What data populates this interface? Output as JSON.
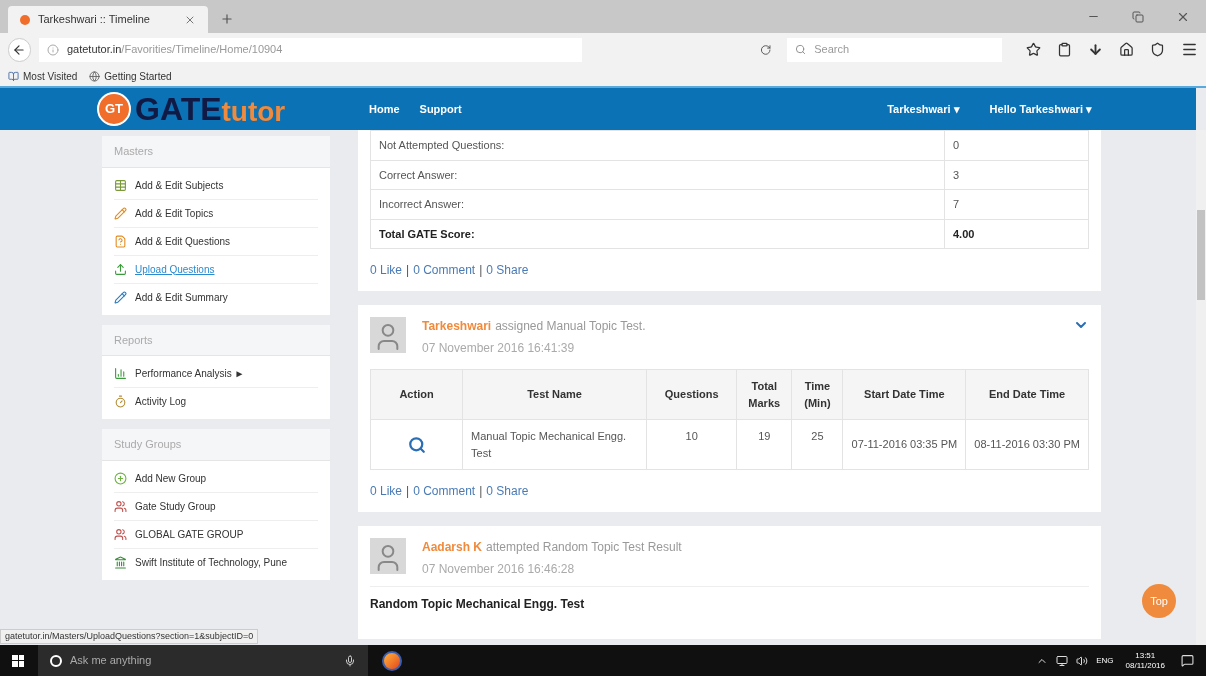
{
  "browser": {
    "tab_title": "Tarkeshwari :: Timeline",
    "url_host": "gatetutor.in",
    "url_path": "/Favorities/Timeline/Home/10904",
    "search_placeholder": "Search",
    "bookmarks": [
      "Most Visited",
      "Getting Started"
    ]
  },
  "header": {
    "logo": {
      "badge": "GT",
      "main": "GATE",
      "accent": "tutor"
    },
    "nav": [
      "Home",
      "Support"
    ],
    "menus": [
      "Tarkeshwari ▾",
      "Hello Tarkeshwari ▾"
    ]
  },
  "sidebar": {
    "sections": [
      {
        "title": "Masters",
        "items": [
          {
            "label": "Add & Edit Subjects",
            "hovered": false
          },
          {
            "label": "Add & Edit Topics",
            "hovered": false
          },
          {
            "label": "Add & Edit Questions",
            "hovered": false
          },
          {
            "label": "Upload Questions",
            "hovered": true
          },
          {
            "label": "Add & Edit Summary",
            "hovered": false
          }
        ]
      },
      {
        "title": "Reports",
        "items": [
          {
            "label": "Performance Analysis ►",
            "hovered": false
          },
          {
            "label": "Activity Log",
            "hovered": false
          }
        ]
      },
      {
        "title": "Study Groups",
        "items": [
          {
            "label": "Add New Group",
            "hovered": false
          },
          {
            "label": "Gate Study Group",
            "hovered": false
          },
          {
            "label": "GLOBAL GATE GROUP",
            "hovered": false
          },
          {
            "label": "Swift Institute of Technology, Pune",
            "hovered": false
          }
        ]
      }
    ]
  },
  "feed": {
    "link_separator": "|",
    "result_post": {
      "rows": [
        {
          "label": "Not Attempted Questions:",
          "value": "0",
          "bold": false
        },
        {
          "label": "Correct Answer:",
          "value": "3",
          "bold": false
        },
        {
          "label": "Incorrect Answer:",
          "value": "7",
          "bold": false
        },
        {
          "label": "Total GATE Score:",
          "value": "4.00",
          "bold": true
        }
      ],
      "links": [
        "0 Like",
        "0 Comment",
        "0 Share"
      ]
    },
    "assign_post": {
      "author": "Tarkeshwari",
      "action": "assigned Manual Topic Test.",
      "time": "07 November 2016 16:41:39",
      "expanded": false,
      "table": {
        "columns": [
          "Action",
          "Test Name",
          "Questions",
          "Total Marks",
          "Time (Min)",
          "Start Date Time",
          "End Date Time"
        ],
        "rows": [
          {
            "test_name": "Manual Topic Mechanical Engg. Test",
            "questions": "10",
            "total_marks": "19",
            "time": "25",
            "start": "07-11-2016 03:35 PM",
            "end": "08-11-2016 03:30 PM"
          }
        ]
      },
      "links": [
        "0 Like",
        "0 Comment",
        "0 Share"
      ]
    },
    "attempt_post": {
      "author": "Aadarsh K",
      "action": "attempted Random Topic Test Result",
      "time": "07 November 2016 16:46:28",
      "title": "Random Topic Mechanical Engg. Test"
    }
  },
  "top_button": "Top",
  "status_link": "gatetutor.in/Masters/UploadQuestions?section=1&subjectID=0",
  "taskbar": {
    "search_placeholder": "Ask me anything",
    "language": "ENG",
    "time": "13:51",
    "date": "08/11/2016"
  }
}
